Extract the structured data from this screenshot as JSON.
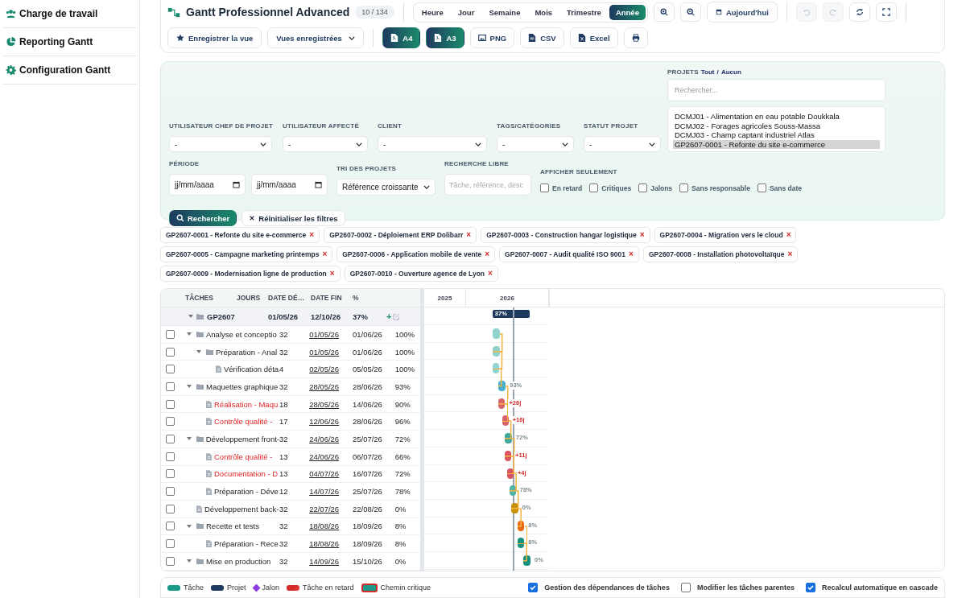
{
  "sidebar": {
    "items": [
      {
        "label": "Charge de travail"
      },
      {
        "label": "Reporting Gantt"
      },
      {
        "label": "Configuration Gantt"
      }
    ]
  },
  "toolbar": {
    "title": "Gantt Professionnel Advanced",
    "count": "10 / 134",
    "scales": [
      {
        "label": "Heure",
        "selected": false
      },
      {
        "label": "Jour",
        "selected": false
      },
      {
        "label": "Semaine",
        "selected": false
      },
      {
        "label": "Mois",
        "selected": false
      },
      {
        "label": "Trimestre",
        "selected": false
      },
      {
        "label": "Année",
        "selected": true
      }
    ],
    "today": "Aujourd'hui",
    "history": [
      {
        "kind": "undo",
        "disabled": true
      },
      {
        "kind": "redo",
        "disabled": true
      },
      {
        "kind": "refresh",
        "disabled": false
      },
      {
        "kind": "fullscreen",
        "disabled": false
      }
    ],
    "save_view": "Enregistrer la vue",
    "saved_views": "Vues enregistrées",
    "exports": [
      {
        "label": "A4",
        "kind": "pdf",
        "primary": true
      },
      {
        "label": "A3",
        "kind": "pdf",
        "primary": true
      },
      {
        "label": "PNG",
        "kind": "image",
        "primary": false
      },
      {
        "label": "CSV",
        "kind": "file",
        "primary": false
      },
      {
        "label": "Excel",
        "kind": "sheet",
        "primary": false
      }
    ]
  },
  "filters": {
    "selects": [
      {
        "label": "UTILISATEUR CHEF DE PROJET",
        "value": "-"
      },
      {
        "label": "UTILISATEUR AFFECTÉ",
        "value": "-"
      },
      {
        "label": "CLIENT",
        "value": "-"
      },
      {
        "label": "TAGS/CATÉGORIES",
        "value": "-"
      },
      {
        "label": "STATUT PROJET",
        "value": "-"
      }
    ],
    "projects": {
      "label": "PROJETS",
      "all": "Tout",
      "separator": "/",
      "none": "Aucun",
      "placeholder": "Rechercher...",
      "options": [
        {
          "label": "DCMJ01 - Alimentation en eau potable Doukkala",
          "selected": false
        },
        {
          "label": "DCMJ02 - Forages agricoles Souss-Massa",
          "selected": false
        },
        {
          "label": "DCMJ03 - Champ captant industriel Atlas",
          "selected": false
        },
        {
          "label": "GP2607-0001 - Refonte du site e-commerce",
          "selected": true
        }
      ]
    },
    "period": {
      "label": "PÉRIODE",
      "from_placeholder": "jj/mm/aaaa",
      "to_placeholder": "jj/mm/aaaa"
    },
    "sort": {
      "label": "TRI DES PROJETS",
      "value": "Référence croissante"
    },
    "free_search": {
      "label": "RECHERCHE LIBRE",
      "placeholder": "Tâche, référence, desc"
    },
    "show_only": {
      "label": "AFFICHER SEULEMENT",
      "options": [
        {
          "label": "En retard",
          "checked": false
        },
        {
          "label": "Critiques",
          "checked": false
        },
        {
          "label": "Jalons",
          "checked": false
        },
        {
          "label": "Sans responsable",
          "checked": false
        },
        {
          "label": "Sans date",
          "checked": false
        }
      ]
    },
    "search_button": "Rechercher",
    "reset_button": "Réinitialiser les filtres"
  },
  "chips": [
    {
      "label": "GP2607-0001 - Refonte du site e-commerce",
      "remove": "×"
    },
    {
      "label": "GP2607-0002 - Déploiement ERP Dolibarr",
      "remove": "×"
    },
    {
      "label": "GP2607-0003 - Construction hangar logistique",
      "remove": "×"
    },
    {
      "label": "GP2607-0004 - Migration vers le cloud",
      "remove": "×"
    },
    {
      "label": "GP2607-0005 - Campagne marketing printemps",
      "remove": "×"
    },
    {
      "label": "GP2607-0006 - Application mobile de vente",
      "remove": "×"
    },
    {
      "label": "GP2607-0007 - Audit qualité ISO 9001",
      "remove": "×"
    },
    {
      "label": "GP2607-0008 - Installation photovoltaïque",
      "remove": "×"
    },
    {
      "label": "GP2607-0009 - Modernisation ligne de production",
      "remove": "×"
    },
    {
      "label": "GP2607-0010 - Ouverture agence de Lyon",
      "remove": "×"
    }
  ],
  "gantt": {
    "columns": [
      "TÂCHES",
      "JOURS",
      "DATE DÉ…",
      "DATE FIN",
      "%"
    ],
    "years": [
      "2025",
      "2026"
    ],
    "project": {
      "name": "GP2607",
      "start": "01/05/26",
      "end": "12/10/26",
      "percent": "37%",
      "add": "+",
      "expanded": true,
      "bar_label": "37%",
      "children": [
        {
          "kind": "folder",
          "name": "Analyse et conceptio",
          "days": "32",
          "start": "01/05/26",
          "end": "01/06/26",
          "percent": "100%",
          "checked": false,
          "late": false,
          "expanded": true,
          "color": "#8fd3cc",
          "children": [
            {
              "kind": "folder",
              "name": "Préparation - Anal",
              "days": "32",
              "start": "01/05/26",
              "end": "01/06/26",
              "percent": "100%",
              "checked": false,
              "late": false,
              "expanded": true,
              "color": "#8fd3cc",
              "children": [
                {
                  "kind": "file",
                  "name": "Vérification déta",
                  "days": "4",
                  "start": "02/05/26",
                  "end": "05/05/26",
                  "percent": "100%",
                  "checked": false,
                  "late": false,
                  "color": "#8fd3cc"
                }
              ]
            }
          ]
        },
        {
          "kind": "folder",
          "name": "Maquettes graphique",
          "days": "32",
          "start": "28/05/26",
          "end": "28/06/26",
          "percent": "93%",
          "checked": false,
          "late": false,
          "expanded": true,
          "color": "#4bb0cf",
          "bar_label": "93%",
          "children": [
            {
              "kind": "file",
              "name": "Réalisation - Maqu",
              "days": "18",
              "start": "28/05/26",
              "end": "14/06/26",
              "percent": "90%",
              "checked": false,
              "late": true,
              "color": "#d9646c",
              "bar_label": "+26j"
            },
            {
              "kind": "file",
              "name": "Contrôle qualité -",
              "days": "17",
              "start": "12/06/26",
              "end": "28/06/26",
              "percent": "96%",
              "checked": false,
              "late": true,
              "color": "#d9646c",
              "bar_label": "+16j"
            }
          ]
        },
        {
          "kind": "folder",
          "name": "Développement front-",
          "days": "32",
          "start": "24/06/26",
          "end": "25/07/26",
          "percent": "72%",
          "checked": false,
          "late": false,
          "expanded": true,
          "color": "#3fa79c",
          "bar_label": "72%",
          "children": [
            {
              "kind": "file",
              "name": "Contrôle qualité -",
              "days": "13",
              "start": "24/06/26",
              "end": "06/07/26",
              "percent": "66%",
              "checked": false,
              "late": true,
              "color": "#d9545e",
              "bar_label": "+11j"
            },
            {
              "kind": "file",
              "name": "Documentation - D",
              "days": "13",
              "start": "04/07/26",
              "end": "16/07/26",
              "percent": "72%",
              "checked": false,
              "late": true,
              "color": "#d9545e",
              "bar_label": "+4j"
            },
            {
              "kind": "file",
              "name": "Préparation - Déve",
              "days": "12",
              "start": "14/07/26",
              "end": "25/07/26",
              "percent": "78%",
              "checked": false,
              "late": false,
              "color": "#4fb3a8",
              "bar_label": "78%"
            }
          ]
        },
        {
          "kind": "file",
          "name": "Développement back-",
          "days": "32",
          "start": "22/07/26",
          "end": "22/08/26",
          "percent": "0%",
          "checked": false,
          "late": false,
          "color": "#c8900a",
          "bar_label": "0%"
        },
        {
          "kind": "folder",
          "name": "Recette et tests",
          "days": "32",
          "start": "18/08/26",
          "end": "18/09/26",
          "percent": "8%",
          "checked": false,
          "late": false,
          "expanded": true,
          "color": "#e86a12",
          "bar_label": "8%",
          "children": [
            {
              "kind": "file",
              "name": "Préparation - Rece",
              "days": "32",
              "start": "18/08/26",
              "end": "18/09/26",
              "percent": "8%",
              "checked": false,
              "late": false,
              "color": "#17917f",
              "bar_label": "8%"
            }
          ]
        },
        {
          "kind": "folder",
          "name": "Mise en production",
          "days": "32",
          "start": "14/09/26",
          "end": "15/10/26",
          "percent": "0%",
          "checked": false,
          "late": false,
          "expanded": true,
          "color": "#17917f",
          "bar_label": "0%"
        }
      ]
    }
  },
  "legend": {
    "items": [
      {
        "kind": "task",
        "label": "Tâche",
        "color": "#1a9a86"
      },
      {
        "kind": "project",
        "label": "Projet",
        "color": "#1e3a5f"
      },
      {
        "kind": "milestone",
        "label": "Jalon",
        "color": "#8b3fe0"
      },
      {
        "kind": "late",
        "label": "Tâche en retard",
        "color": "#d42a2a"
      },
      {
        "kind": "critical",
        "label": "Chemin critique",
        "color": "#1a9a86"
      }
    ],
    "options": [
      {
        "label": "Gestion des dépendances de tâches",
        "checked": true
      },
      {
        "label": "Modifier les tâches parentes",
        "checked": false
      },
      {
        "label": "Recalcul automatique en cascade",
        "checked": true
      }
    ]
  }
}
